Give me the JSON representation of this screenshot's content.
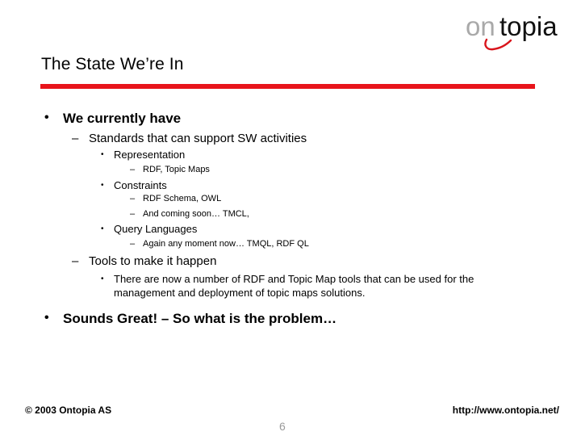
{
  "logo": {
    "text_grey": "on",
    "text_black": "topia",
    "grey_color": "#a9a9a9",
    "accent_color": "#d9141b"
  },
  "slide": {
    "title": "The State We’re In",
    "rule_color": "#e8141b",
    "bullets": [
      {
        "marker": "•",
        "text": "We currently have",
        "children": [
          {
            "marker": "–",
            "text": "Standards that can support SW activities",
            "children": [
              {
                "marker": "•",
                "text": "Representation",
                "children": [
                  {
                    "marker": "–",
                    "text": "RDF, Topic Maps"
                  }
                ]
              },
              {
                "marker": "•",
                "text": "Constraints",
                "children": [
                  {
                    "marker": "–",
                    "text": "RDF Schema, OWL"
                  },
                  {
                    "marker": "–",
                    "text": "And coming soon… TMCL,"
                  }
                ]
              },
              {
                "marker": "•",
                "text": "Query Languages",
                "children": [
                  {
                    "marker": "–",
                    "text": "Again any moment now… TMQL, RDF QL"
                  }
                ]
              }
            ]
          },
          {
            "marker": "–",
            "text": "Tools to make it happen",
            "children": [
              {
                "marker": "•",
                "text_line1": "There are now a number of RDF and Topic Map tools that can be used for the",
                "text_line2": "management and deployment of topic maps solutions."
              }
            ]
          }
        ]
      },
      {
        "marker": "•",
        "text": "Sounds Great! – So what is the problem…"
      }
    ]
  },
  "footer": {
    "copyright": "© 2003 Ontopia AS",
    "url": "http://www.ontopia.net/",
    "page_number": "6"
  }
}
